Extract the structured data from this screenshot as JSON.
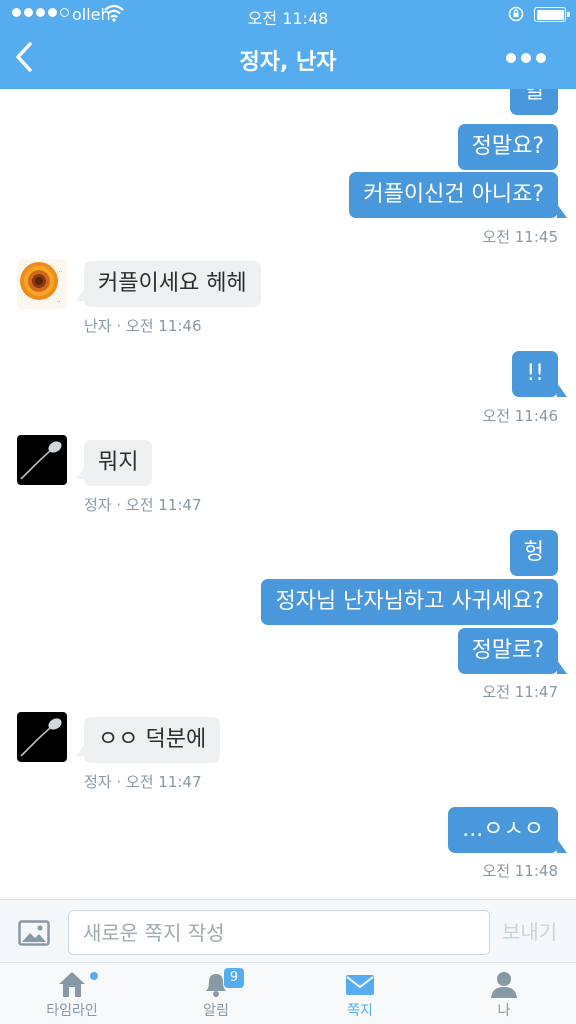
{
  "status_bar": {
    "carrier": "olleh",
    "time": "오전 11:48"
  },
  "nav": {
    "title": "정자, 난자",
    "back_icon": "chevron-left-icon",
    "more_icon": "ellipsis-icon"
  },
  "messages": [
    {
      "dir": "out",
      "text": "헐"
    },
    {
      "dir": "out",
      "text": "정말요?"
    },
    {
      "dir": "out",
      "text": "커플이신건 아니죠?"
    },
    {
      "meta": "오전 11:45"
    },
    {
      "dir": "in",
      "sender": "난자",
      "text": "커플이세요 헤헤"
    },
    {
      "meta": "난자 · 오전 11:46"
    },
    {
      "dir": "out",
      "text": "!!"
    },
    {
      "meta": "오전 11:46"
    },
    {
      "dir": "in",
      "sender": "정자",
      "text": "뭐지"
    },
    {
      "meta": "정자 · 오전 11:47"
    },
    {
      "dir": "out",
      "text": "헝"
    },
    {
      "dir": "out",
      "text": "정자님 난자님하고 사귀세요?"
    },
    {
      "dir": "out",
      "text": "정말로?"
    },
    {
      "meta": "오전 11:47"
    },
    {
      "dir": "in",
      "sender": "정자",
      "text": "ㅇㅇ 덕분에"
    },
    {
      "meta": "정자 · 오전 11:47"
    },
    {
      "dir": "out",
      "text": "...ㅇㅅㅇ"
    },
    {
      "meta": "오전 11:48"
    }
  ],
  "composer": {
    "placeholder": "새로운 쪽지 작성",
    "send_label": "보내기",
    "photo_icon": "image-icon"
  },
  "tabs": [
    {
      "label": "타임라인",
      "icon": "home-icon",
      "active": false,
      "indicator": "dot"
    },
    {
      "label": "알림",
      "icon": "bell-icon",
      "active": false,
      "badge": "9"
    },
    {
      "label": "쪽지",
      "icon": "envelope-icon",
      "active": true
    },
    {
      "label": "나",
      "icon": "person-icon",
      "active": false
    }
  ],
  "colors": {
    "brand": "#55acee",
    "outgoing_bubble": "#4a98dc",
    "incoming_bubble": "#eef0f2",
    "meta_text": "#8899a6"
  }
}
